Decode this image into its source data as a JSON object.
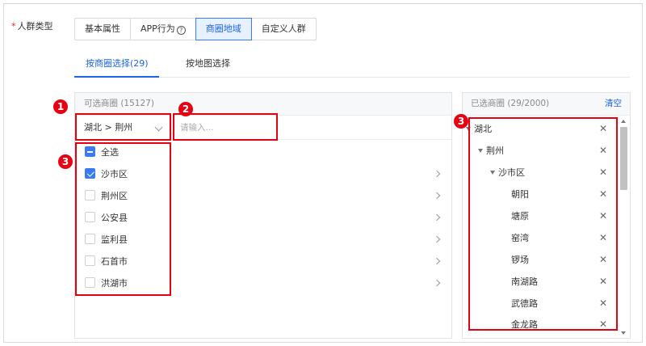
{
  "field": {
    "required_mark": "*",
    "label": "人群类型"
  },
  "segment_tabs": [
    {
      "label": "基本属性",
      "active": false,
      "help_icon": null
    },
    {
      "label": "APP行为",
      "active": false,
      "help_icon": "question-circle-icon"
    },
    {
      "label": "商圈地域",
      "active": true,
      "help_icon": null
    },
    {
      "label": "自定义人群",
      "active": false,
      "help_icon": null
    }
  ],
  "sub_tabs": [
    {
      "label": "按商圈选择(29)",
      "active": true
    },
    {
      "label": "按地图选择",
      "active": false
    }
  ],
  "left_panel": {
    "title": "可选商圈 (15127)",
    "region_select": {
      "value": "湖北 > 荆州",
      "icon": "chevron-down-icon"
    },
    "search": {
      "placeholder": "请输入..."
    },
    "select_all": {
      "label": "全选",
      "state": "indeterminate"
    },
    "items": [
      {
        "label": "沙市区",
        "checked": true
      },
      {
        "label": "荆州区",
        "checked": false
      },
      {
        "label": "公安县",
        "checked": false
      },
      {
        "label": "监利县",
        "checked": false
      },
      {
        "label": "石首市",
        "checked": false
      },
      {
        "label": "洪湖市",
        "checked": false
      }
    ]
  },
  "right_panel": {
    "title": "已选商圈 (29/2000)",
    "clear_label": "清空",
    "remove_icon": "close-icon",
    "tree": [
      {
        "label": "湖北",
        "level": 0,
        "expanded": true
      },
      {
        "label": "荆州",
        "level": 1,
        "expanded": true
      },
      {
        "label": "沙市区",
        "level": 2,
        "expanded": true
      },
      {
        "label": "朝阳",
        "level": 3
      },
      {
        "label": "塘原",
        "level": 3
      },
      {
        "label": "窑湾",
        "level": 3
      },
      {
        "label": "锣场",
        "level": 3
      },
      {
        "label": "南湖路",
        "level": 3
      },
      {
        "label": "武德路",
        "level": 3
      },
      {
        "label": "金龙路",
        "level": 3
      }
    ]
  },
  "annotations": [
    {
      "number": "1",
      "target": "region-select"
    },
    {
      "number": "2",
      "target": "search-input"
    },
    {
      "number": "3",
      "target": "left-checkbox-list"
    },
    {
      "number": "3",
      "target": "selected-tree"
    }
  ],
  "colors": {
    "accent": "#1e64e6",
    "annotation": "#e60012",
    "active_tab_bg": "#e8f1ff"
  }
}
